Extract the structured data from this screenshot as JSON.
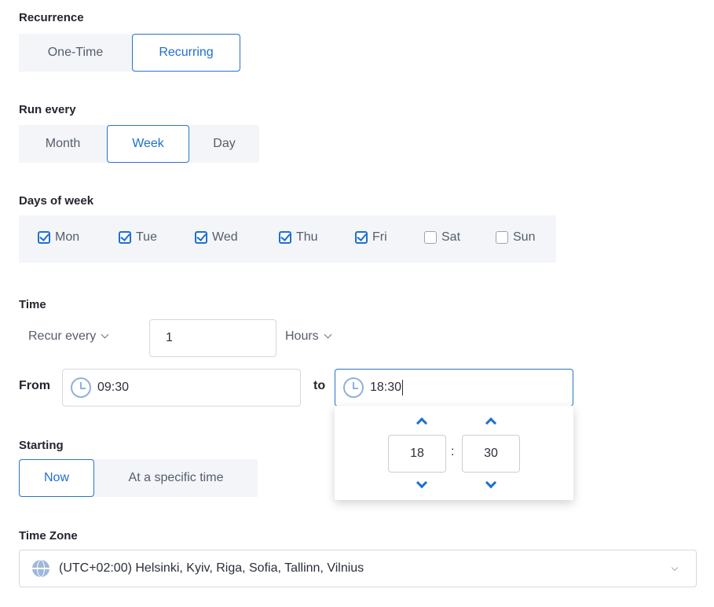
{
  "recurrence": {
    "label": "Recurrence",
    "options": [
      "One-Time",
      "Recurring"
    ],
    "selected": "Recurring"
  },
  "run_every": {
    "label": "Run every",
    "options": [
      "Month",
      "Week",
      "Day"
    ],
    "selected": "Week"
  },
  "days_of_week": {
    "label": "Days of week",
    "days": [
      {
        "label": "Mon",
        "checked": true
      },
      {
        "label": "Tue",
        "checked": true
      },
      {
        "label": "Wed",
        "checked": true
      },
      {
        "label": "Thu",
        "checked": true
      },
      {
        "label": "Fri",
        "checked": true
      },
      {
        "label": "Sat",
        "checked": false
      },
      {
        "label": "Sun",
        "checked": false
      }
    ]
  },
  "time": {
    "label": "Time",
    "recur_mode": "Recur every",
    "interval_value": "1",
    "interval_unit": "Hours",
    "from_label": "From",
    "from_value": "09:30",
    "to_label": "to",
    "to_value": "18:30"
  },
  "time_picker": {
    "hours": "18",
    "separator": ":",
    "minutes": "30"
  },
  "starting": {
    "label": "Starting",
    "options": [
      "Now",
      "At a specific time"
    ],
    "selected": "Now"
  },
  "time_zone": {
    "label": "Time Zone",
    "value": "(UTC+02:00) Helsinki, Kyiv, Riga, Sofia, Tallinn, Vilnius"
  },
  "colors": {
    "accent": "#1f6fcf",
    "segment_bg": "#f3f5f8"
  }
}
